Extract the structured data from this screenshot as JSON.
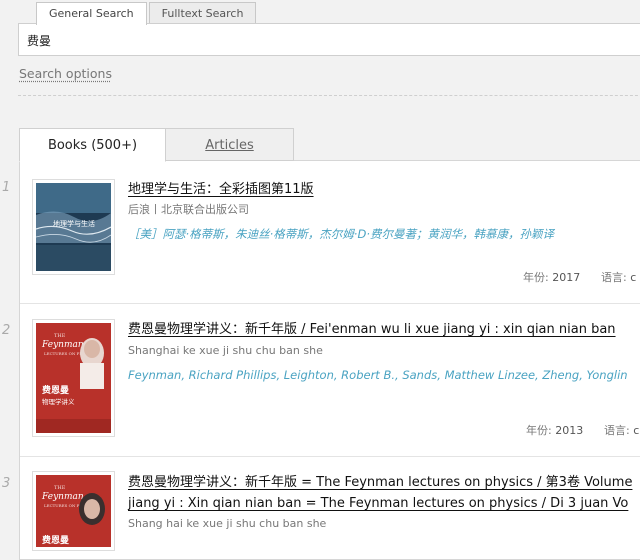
{
  "search_tabs": [
    "General Search",
    "Fulltext Search"
  ],
  "search": {
    "query": "费曼"
  },
  "search_options_label": "Search options",
  "result_tabs": {
    "books": "Books (500+)",
    "articles": "Articles"
  },
  "results": [
    {
      "index": "1",
      "title_line1": "地理学与生活：全彩插图第11版",
      "title_line2": "",
      "publisher": "后浪丨北京联合出版公司",
      "authors": "［美］阿瑟·格蒂斯，朱迪丝·格蒂斯，杰尔姆·D·费尔曼著；黄润华，韩慕康，孙颖译",
      "year_label": "年份:",
      "year": "2017",
      "lang_label": "语言:",
      "lang": "c"
    },
    {
      "index": "2",
      "title_line1": "费恩曼物理学讲义：新千年版 / Fei'enman wu li xue jiang yi : xin qian nian ban",
      "title_line2": "",
      "publisher": "Shanghai ke xue ji shu chu ban she",
      "authors": "Feynman, Richard Phillips, Leighton, Robert B., Sands, Matthew Linzee, Zheng, Yonglin",
      "year_label": "年份:",
      "year": "2013",
      "lang_label": "语言:",
      "lang": "c"
    },
    {
      "index": "3",
      "title_line1": "费恩曼物理学讲义：新千年版 = The Feynman lectures on physics / 第3卷 Volume",
      "title_line2": "jiang yi : Xin qian nian ban = The Feynman lectures on physics / Di 3 juan Vo",
      "publisher": "Shang hai ke xue ji shu chu ban she",
      "authors": "",
      "year_label": "",
      "year": "",
      "lang_label": "",
      "lang": ""
    }
  ],
  "cover_texts": {
    "book1": "地理学与生活",
    "book2_top": "THE",
    "book2_brand": "Feynman",
    "book2_sub": "LECTURES ON PHYSICS",
    "book2_cn": "费恩曼",
    "book2_cn2": "物理学讲义",
    "book3_top": "THE",
    "book3_brand": "Feynman",
    "book3_sub": "LECTURES ON PHYSICS",
    "book3_cn": "费恩曼"
  },
  "colors": {
    "author_link": "#4aa3c2",
    "feynman_red": "#b8312a"
  }
}
